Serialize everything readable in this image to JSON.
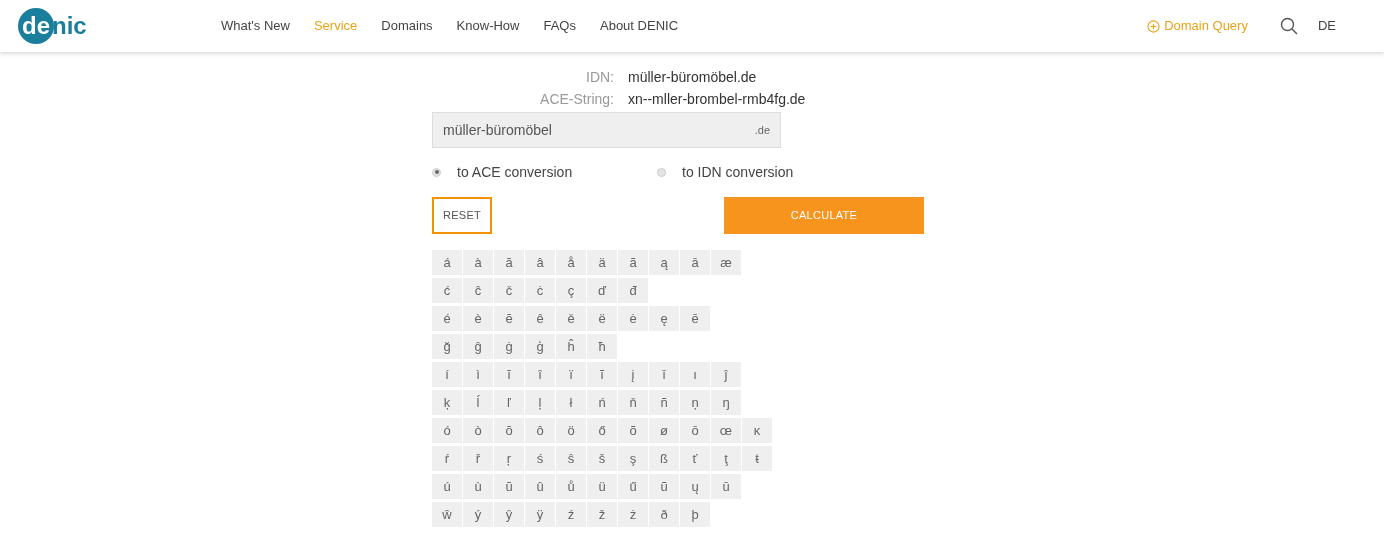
{
  "logo": {
    "part_1": "de",
    "part_2": "nic"
  },
  "nav": [
    {
      "label": "What's New",
      "selected": false
    },
    {
      "label": "Service",
      "selected": true
    },
    {
      "label": "Domains",
      "selected": false
    },
    {
      "label": "Know-How",
      "selected": false
    },
    {
      "label": "FAQs",
      "selected": false
    },
    {
      "label": "About DENIC",
      "selected": false
    }
  ],
  "domain_query": "Domain Query",
  "language": "DE",
  "results": [
    {
      "label": "IDN:",
      "value": "müller-büromöbel.de"
    },
    {
      "label": "ACE-String:",
      "value": "xn--mller-brombel-rmb4fg.de"
    }
  ],
  "domain_field": {
    "value": "müller-büromöbel",
    "suffix": ".de"
  },
  "conversion": [
    {
      "label": "to ACE conversion",
      "selected": true
    },
    {
      "label": "to IDN conversion",
      "selected": false
    }
  ],
  "buttons": {
    "reset": "RESET",
    "calculate": "CALCULATE"
  },
  "characters": [
    [
      "á",
      "à",
      "ă",
      "â",
      "å",
      "ä",
      "ã",
      "ą",
      "ā",
      "æ"
    ],
    [
      "ć",
      "ĉ",
      "č",
      "ċ",
      "ç",
      "ď",
      "đ"
    ],
    [
      "é",
      "è",
      "ĕ",
      "ê",
      "ě",
      "ë",
      "ė",
      "ę",
      "ē"
    ],
    [
      "ğ",
      "ĝ",
      "ġ",
      "ģ",
      "ĥ",
      "ħ"
    ],
    [
      "í",
      "ì",
      "ĭ",
      "î",
      "ï",
      "ĩ",
      "į",
      "ī",
      "ı",
      "ĵ"
    ],
    [
      "ķ",
      "ĺ",
      "ľ",
      "ļ",
      "ł",
      "ń",
      "ň",
      "ñ",
      "ņ",
      "ŋ"
    ],
    [
      "ó",
      "ò",
      "ŏ",
      "ô",
      "ö",
      "ő",
      "õ",
      "ø",
      "ō",
      "œ",
      "ĸ"
    ],
    [
      "ŕ",
      "ř",
      "ŗ",
      "ś",
      "ŝ",
      "š",
      "ş",
      "ß",
      "ť",
      "ţ",
      "ŧ"
    ],
    [
      "ú",
      "ù",
      "ŭ",
      "û",
      "ů",
      "ü",
      "ű",
      "ũ",
      "ų",
      "ū"
    ],
    [
      "ŵ",
      "ý",
      "ŷ",
      "ÿ",
      "ź",
      "ž",
      "ż",
      "ð",
      "þ"
    ]
  ]
}
